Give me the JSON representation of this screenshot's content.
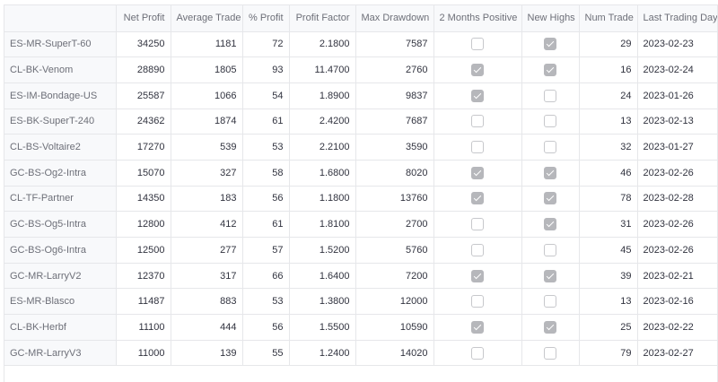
{
  "columns": [
    "",
    "Net Profit",
    "Average Trade",
    "% Profit",
    "Profit Factor",
    "Max Drawdown",
    "2 Months Positive",
    "New Highs",
    "Num Trade",
    "Last Trading Day"
  ],
  "rows": [
    {
      "name": "ES-MR-SuperT-60",
      "net_profit": "34250",
      "avg_trade": "1181",
      "pct_profit": "72",
      "profit_factor": "2.1800",
      "max_drawdown": "7587",
      "two_months_positive": false,
      "new_highs": true,
      "num_trade": "29",
      "last_day": "2023-02-23"
    },
    {
      "name": "CL-BK-Venom",
      "net_profit": "28890",
      "avg_trade": "1805",
      "pct_profit": "93",
      "profit_factor": "11.4700",
      "max_drawdown": "2760",
      "two_months_positive": true,
      "new_highs": true,
      "num_trade": "16",
      "last_day": "2023-02-24"
    },
    {
      "name": "ES-IM-Bondage-US",
      "net_profit": "25587",
      "avg_trade": "1066",
      "pct_profit": "54",
      "profit_factor": "1.8900",
      "max_drawdown": "9837",
      "two_months_positive": true,
      "new_highs": false,
      "num_trade": "24",
      "last_day": "2023-01-26"
    },
    {
      "name": "ES-BK-SuperT-240",
      "net_profit": "24362",
      "avg_trade": "1874",
      "pct_profit": "61",
      "profit_factor": "2.4200",
      "max_drawdown": "7687",
      "two_months_positive": false,
      "new_highs": false,
      "num_trade": "13",
      "last_day": "2023-02-13"
    },
    {
      "name": "CL-BS-Voltaire2",
      "net_profit": "17270",
      "avg_trade": "539",
      "pct_profit": "53",
      "profit_factor": "2.2100",
      "max_drawdown": "3590",
      "two_months_positive": false,
      "new_highs": false,
      "num_trade": "32",
      "last_day": "2023-01-27"
    },
    {
      "name": "GC-BS-Og2-Intra",
      "net_profit": "15070",
      "avg_trade": "327",
      "pct_profit": "58",
      "profit_factor": "1.6800",
      "max_drawdown": "8020",
      "two_months_positive": true,
      "new_highs": true,
      "num_trade": "46",
      "last_day": "2023-02-26"
    },
    {
      "name": "CL-TF-Partner",
      "net_profit": "14350",
      "avg_trade": "183",
      "pct_profit": "56",
      "profit_factor": "1.1800",
      "max_drawdown": "13760",
      "two_months_positive": true,
      "new_highs": true,
      "num_trade": "78",
      "last_day": "2023-02-28"
    },
    {
      "name": "GC-BS-Og5-Intra",
      "net_profit": "12800",
      "avg_trade": "412",
      "pct_profit": "61",
      "profit_factor": "1.8100",
      "max_drawdown": "2700",
      "two_months_positive": false,
      "new_highs": true,
      "num_trade": "31",
      "last_day": "2023-02-26"
    },
    {
      "name": "GC-BS-Og6-Intra",
      "net_profit": "12500",
      "avg_trade": "277",
      "pct_profit": "57",
      "profit_factor": "1.5200",
      "max_drawdown": "5760",
      "two_months_positive": false,
      "new_highs": false,
      "num_trade": "45",
      "last_day": "2023-02-26"
    },
    {
      "name": "GC-MR-LarryV2",
      "net_profit": "12370",
      "avg_trade": "317",
      "pct_profit": "66",
      "profit_factor": "1.6400",
      "max_drawdown": "7200",
      "two_months_positive": true,
      "new_highs": true,
      "num_trade": "39",
      "last_day": "2023-02-21"
    },
    {
      "name": "ES-MR-Blasco",
      "net_profit": "11487",
      "avg_trade": "883",
      "pct_profit": "53",
      "profit_factor": "1.3800",
      "max_drawdown": "12000",
      "two_months_positive": false,
      "new_highs": false,
      "num_trade": "13",
      "last_day": "2023-02-16"
    },
    {
      "name": "CL-BK-Herbf",
      "net_profit": "11100",
      "avg_trade": "444",
      "pct_profit": "56",
      "profit_factor": "1.5500",
      "max_drawdown": "10590",
      "two_months_positive": true,
      "new_highs": true,
      "num_trade": "25",
      "last_day": "2023-02-22"
    },
    {
      "name": "GC-MR-LarryV3",
      "net_profit": "11000",
      "avg_trade": "139",
      "pct_profit": "55",
      "profit_factor": "1.2400",
      "max_drawdown": "14020",
      "two_months_positive": false,
      "new_highs": false,
      "num_trade": "79",
      "last_day": "2023-02-27"
    }
  ]
}
